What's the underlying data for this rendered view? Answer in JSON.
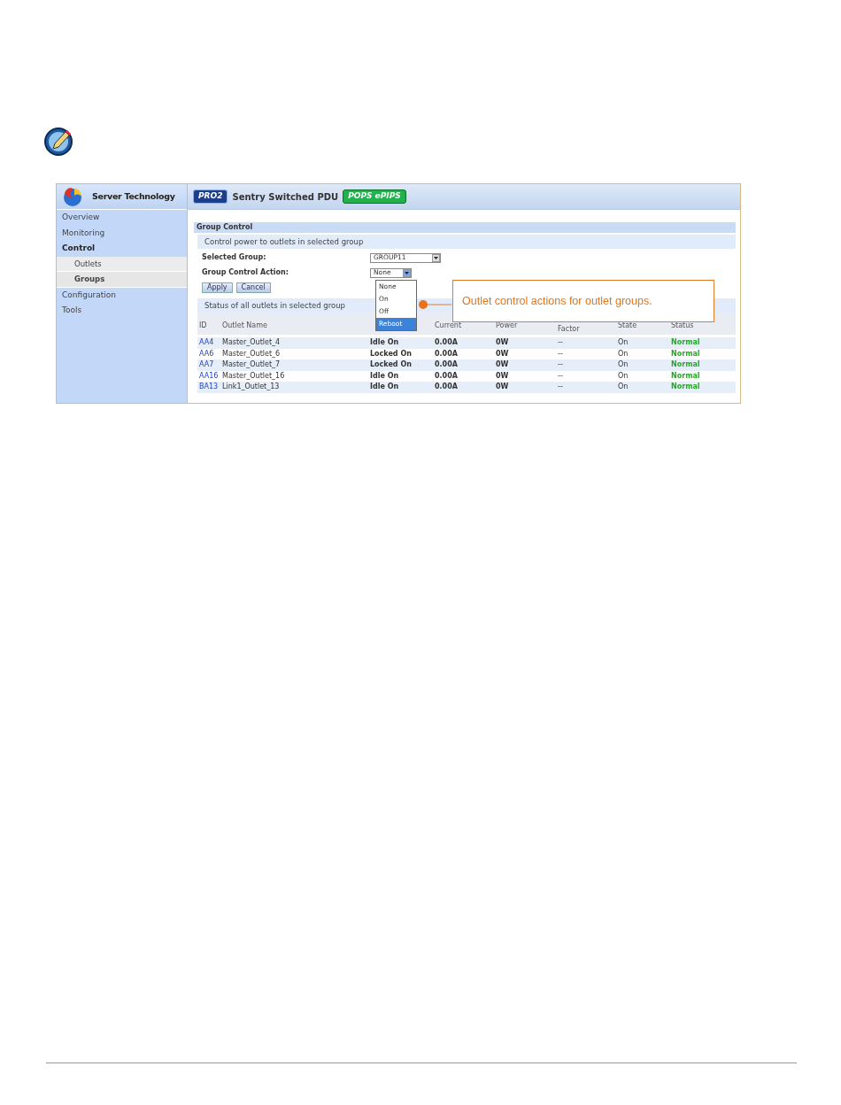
{
  "app": {
    "brand": "Server Technology",
    "product_badge": "PRO2",
    "title": "Sentry Switched PDU",
    "edition_badge": "POPS ePIPS"
  },
  "sidebar": {
    "items": [
      {
        "label": "Overview",
        "selected": false
      },
      {
        "label": "Monitoring",
        "selected": false
      },
      {
        "label": "Control",
        "selected": false,
        "expanded": true,
        "children": [
          {
            "label": "Outlets",
            "selected": false
          },
          {
            "label": "Groups",
            "selected": true
          }
        ]
      },
      {
        "label": "Configuration",
        "selected": false
      },
      {
        "label": "Tools",
        "selected": false
      }
    ]
  },
  "group_control": {
    "title": "Group Control",
    "description": "Control power to outlets in selected group",
    "selected_group": {
      "label": "Selected Group:",
      "value": "GROUP11"
    },
    "action": {
      "label": "Group Control Action:",
      "value": "None",
      "expanded": true,
      "options": [
        {
          "label": "None",
          "highlighted": false
        },
        {
          "label": "On",
          "highlighted": false
        },
        {
          "label": "Off",
          "highlighted": false
        },
        {
          "label": "Reboot",
          "highlighted": true
        }
      ]
    },
    "buttons": [
      "Apply",
      "Cancel"
    ]
  },
  "status": {
    "title": "Status of all outlets in selected group",
    "columns": [
      {
        "label": "ID"
      },
      {
        "label": "Outlet Name"
      },
      {},
      {
        "label": "Current"
      },
      {
        "label": "Power"
      },
      {
        "label": "Factor"
      },
      {
        "label": "State"
      },
      {
        "label": "Status"
      }
    ],
    "rows": [
      [
        "AA4",
        "Master_Outlet_4",
        "Idle On",
        "0.00A",
        "0W",
        "--",
        "On",
        "Normal"
      ],
      [
        "AA6",
        "Master_Outlet_6",
        "Locked On",
        "0.00A",
        "0W",
        "--",
        "On",
        "Normal"
      ],
      [
        "AA7",
        "Master_Outlet_7",
        "Locked On",
        "0.00A",
        "0W",
        "--",
        "On",
        "Normal"
      ],
      [
        "AA16",
        "Master_Outlet_16",
        "Idle On",
        "0.00A",
        "0W",
        "--",
        "On",
        "Normal"
      ],
      [
        "BA13",
        "Link1_Outlet_13",
        "Idle On",
        "0.00A",
        "0W",
        "--",
        "On",
        "Normal"
      ]
    ]
  },
  "callout": {
    "text": "Outlet control actions for outlet groups."
  }
}
